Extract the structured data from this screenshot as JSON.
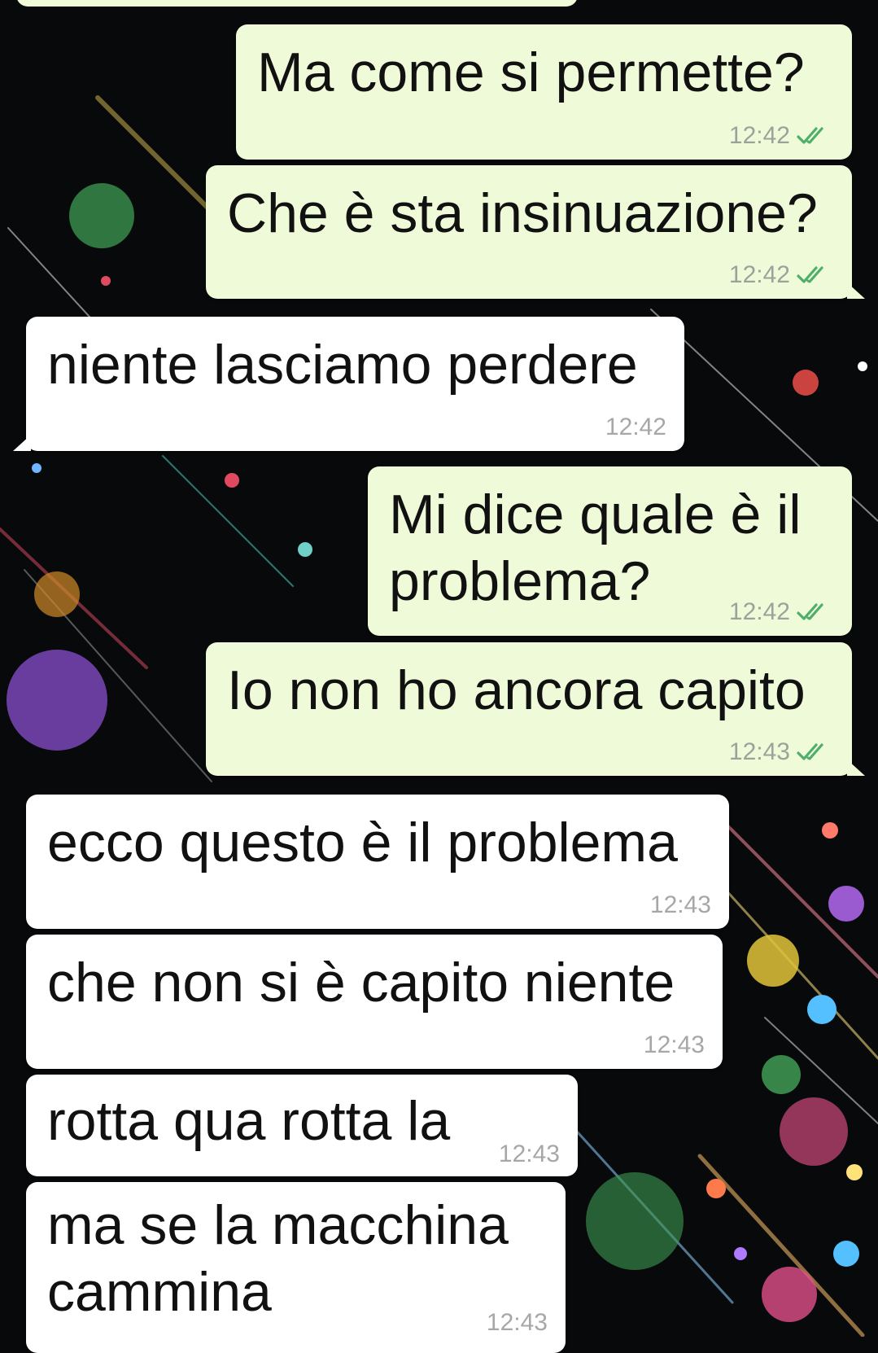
{
  "chat": {
    "messages": [
      {
        "direction": "outgoing",
        "text": "Ma come si permette?",
        "time": "12:42",
        "status": "read-double-check"
      },
      {
        "direction": "outgoing",
        "text": "Che è sta insinuazione?",
        "time": "12:42",
        "status": "read-double-check"
      },
      {
        "direction": "incoming",
        "text": "niente lasciamo perdere",
        "time": "12:42"
      },
      {
        "direction": "outgoing",
        "text_lines": [
          "Mi dice quale è il",
          "problema?"
        ],
        "time": "12:42",
        "status": "read-double-check"
      },
      {
        "direction": "outgoing",
        "text": "Io non ho ancora capito",
        "time": "12:43",
        "status": "read-double-check"
      },
      {
        "direction": "incoming",
        "text": "ecco questo è il problema",
        "time": "12:43"
      },
      {
        "direction": "incoming",
        "text": "che non si è capito niente",
        "time": "12:43"
      },
      {
        "direction": "incoming",
        "text": "rotta qua rotta la",
        "time": "12:43"
      },
      {
        "direction": "incoming",
        "text_lines": [
          "ma se la macchina",
          "cammina"
        ],
        "time": "12:43"
      }
    ]
  },
  "theme": {
    "outgoing_bubble": "#effad9",
    "incoming_bubble": "#ffffff",
    "read_tick": "#4fae6a",
    "timestamp": "#9aa39a",
    "wallpaper": "#07090b"
  },
  "icons": {
    "read_status": "double-check-icon",
    "wallpaper": "starburst-bokeh-wallpaper"
  }
}
